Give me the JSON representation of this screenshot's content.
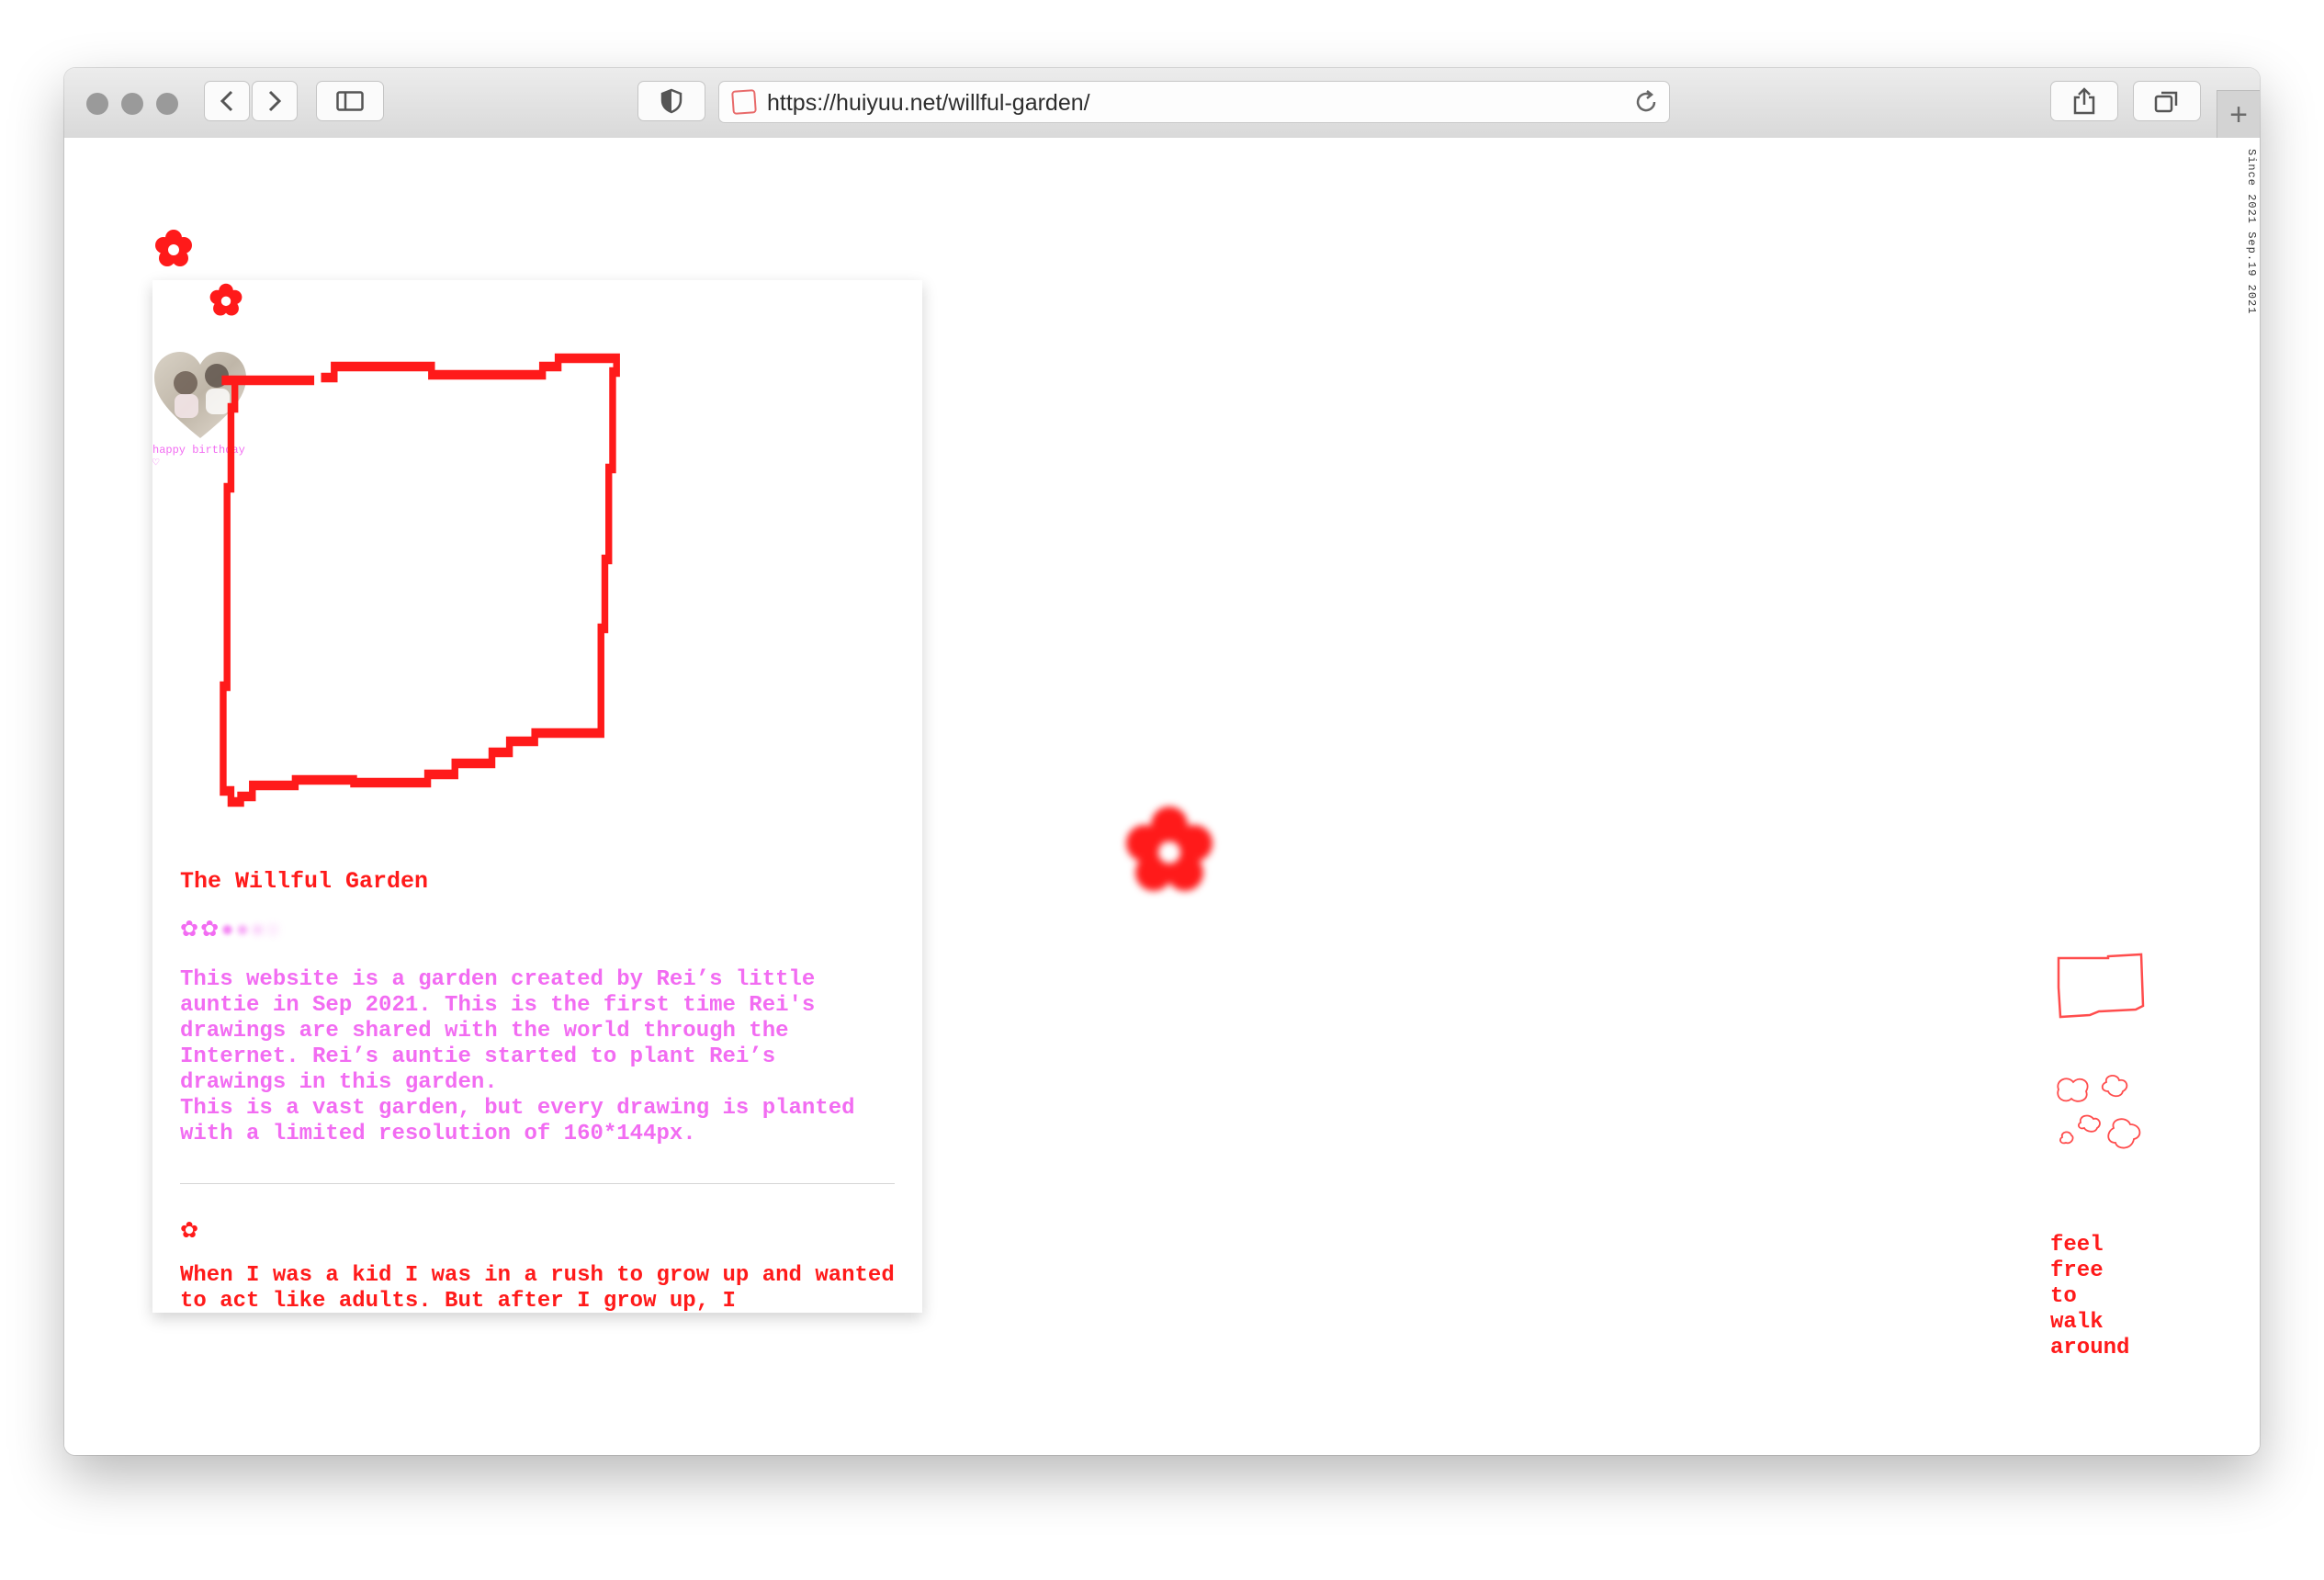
{
  "browser": {
    "url": "https://huiyuu.net/willful-garden/",
    "icons": [
      "back-icon",
      "forward-icon",
      "sidebar-icon",
      "privacy-shield-icon",
      "reload-icon",
      "share-icon",
      "tabs-icon",
      "new-tab-icon"
    ]
  },
  "page": {
    "side_text": "Since 2021 Sep.19 2021",
    "photo_caption": "happy birthday ♡",
    "title": "The Willful Garden",
    "intro": "This website is a garden created by Rei’s little auntie in Sep 2021. This is the first time Rei's drawings are shared with the world through the Internet. Rei’s auntie started to plant Rei’s drawings in this garden.\nThis is a vast garden, but every drawing is planted with a limited resolution of 160*144px.",
    "story": "When I was a kid I was in a rush to grow up and wanted to act like adults. But after I grow up, I",
    "walk_words": [
      "feel",
      "free",
      "to",
      "walk",
      "around"
    ]
  },
  "colors": {
    "accent_red": "#ff1a1a",
    "pink": "#f26cf2",
    "chrome_gray": "#d9d9d9"
  }
}
